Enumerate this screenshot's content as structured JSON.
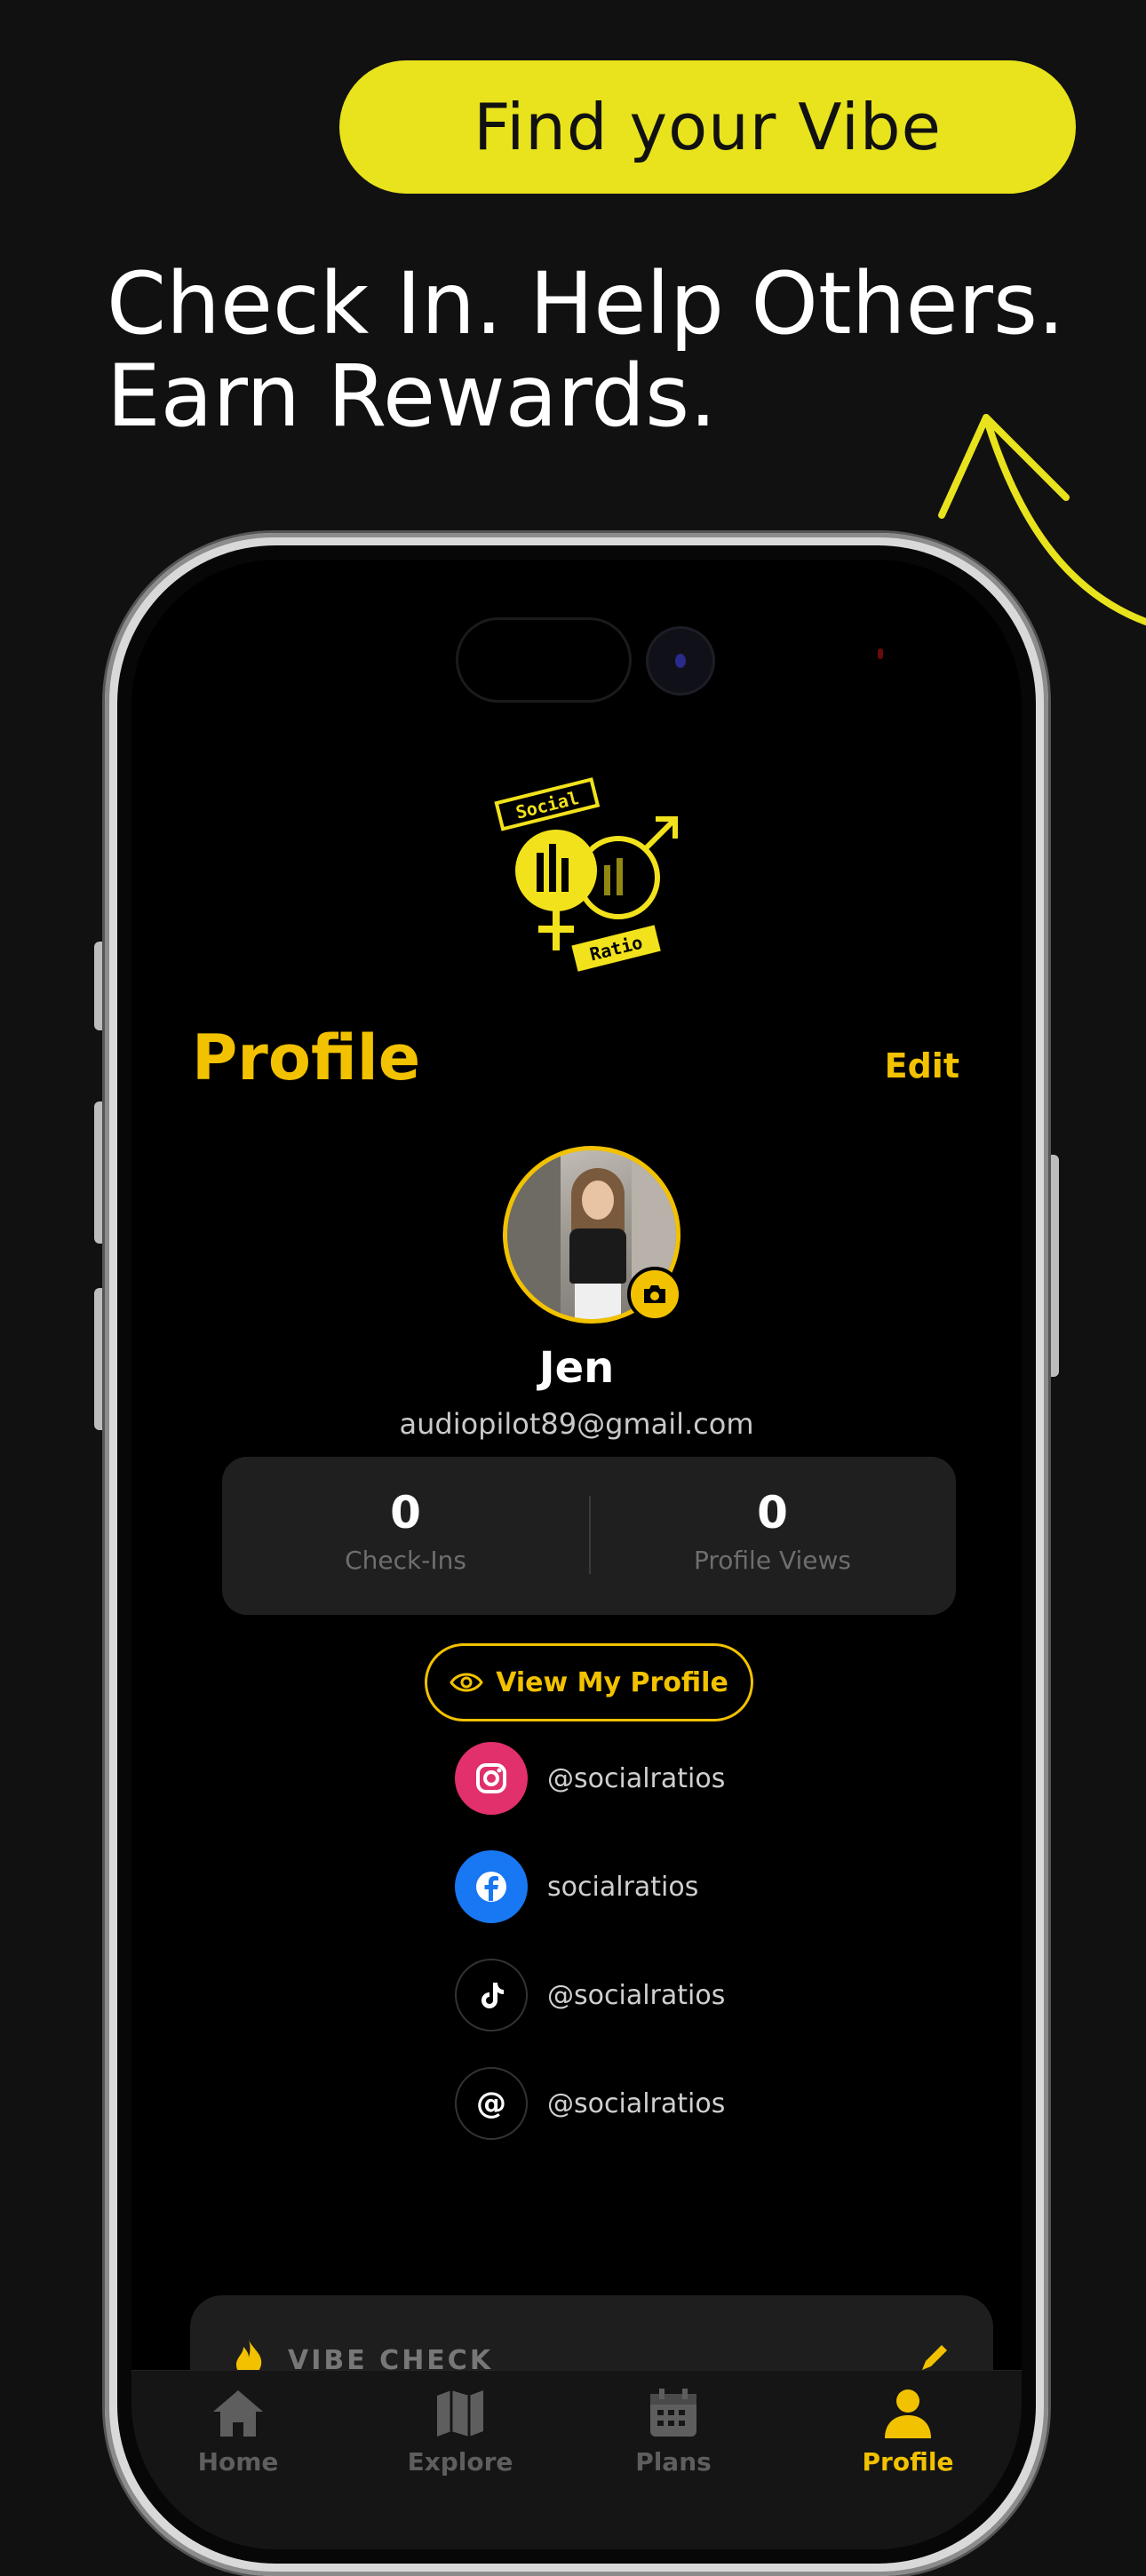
{
  "promo": {
    "pill_text": "Find your Vibe",
    "headline_line1": "Check In. Help Others.",
    "headline_line2": "Earn Rewards."
  },
  "app": {
    "logo_top": "Social",
    "logo_bottom": "Ratio",
    "page_title": "Profile",
    "edit_label": "Edit",
    "user": {
      "name": "Jen",
      "email": "audiopilot89@gmail.com"
    },
    "stats": [
      {
        "value": "0",
        "label": "Check-Ins"
      },
      {
        "value": "0",
        "label": "Profile Views"
      }
    ],
    "view_profile_label": "View My Profile",
    "socials": [
      {
        "icon": "instagram-icon",
        "handle": "@socialratios"
      },
      {
        "icon": "facebook-icon",
        "handle": "socialratios"
      },
      {
        "icon": "tiktok-icon",
        "handle": "@socialratios"
      },
      {
        "icon": "threads-icon",
        "handle": "@socialratios"
      }
    ],
    "vibe_check_label": "VIBE CHECK",
    "tabs": [
      {
        "label": "Home",
        "icon": "home-icon"
      },
      {
        "label": "Explore",
        "icon": "map-icon"
      },
      {
        "label": "Plans",
        "icon": "calendar-icon"
      },
      {
        "label": "Profile",
        "icon": "person-icon",
        "active": true
      }
    ]
  },
  "colors": {
    "accent_yellow": "#f2c200",
    "pill_yellow": "#e8e31c",
    "background": "#121112"
  }
}
